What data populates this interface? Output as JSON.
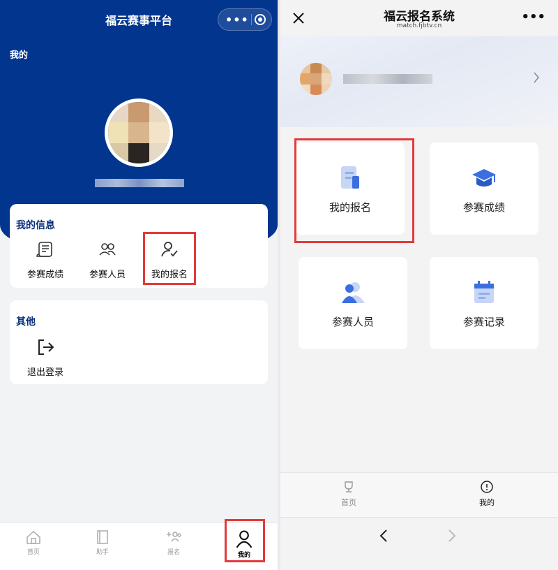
{
  "left": {
    "title": "福云赛事平台",
    "mine_label": "我的",
    "info_card": {
      "title": "我的信息",
      "items": [
        {
          "label": "参赛成绩",
          "icon": "scroll-icon"
        },
        {
          "label": "参赛人员",
          "icon": "people-icon"
        },
        {
          "label": "我的报名",
          "icon": "user-check-icon"
        }
      ]
    },
    "other_card": {
      "title": "其他",
      "items": [
        {
          "label": "退出登录",
          "icon": "logout-icon"
        }
      ]
    },
    "tabbar": [
      {
        "label": "首页",
        "icon": "home-icon"
      },
      {
        "label": "助手",
        "icon": "book-icon"
      },
      {
        "label": "报名",
        "icon": "add-people-icon"
      },
      {
        "label": "我的",
        "icon": "person-icon",
        "active": true
      }
    ],
    "colors": {
      "hero": "#02358e",
      "highlight": "#e23a3a"
    }
  },
  "right": {
    "title": "福云报名系统",
    "subtitle": "match.fjbtv.cn",
    "tiles": [
      {
        "label": "我的报名",
        "icon": "document-icon"
      },
      {
        "label": "参赛成绩",
        "icon": "graduation-cap-icon"
      },
      {
        "label": "参赛人员",
        "icon": "users-icon"
      },
      {
        "label": "参赛记录",
        "icon": "calendar-icon"
      }
    ],
    "tabbar": [
      {
        "label": "首页",
        "icon": "trophy-icon"
      },
      {
        "label": "我的",
        "icon": "user-circle-icon",
        "active": true
      }
    ],
    "colors": {
      "accent": "#3b6fe0",
      "highlight": "#e23a3a"
    }
  }
}
